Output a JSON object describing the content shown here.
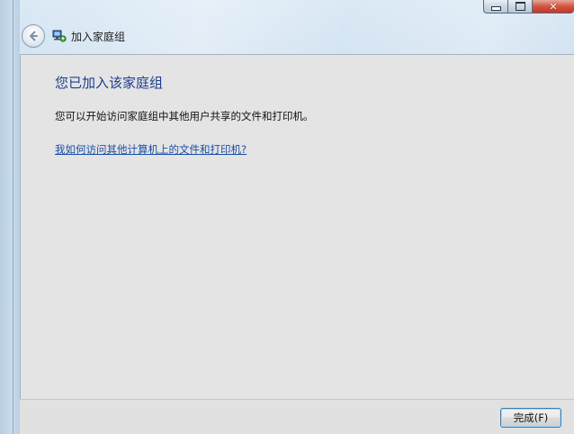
{
  "window": {
    "title": "加入家庭组",
    "caption_buttons": {
      "minimize_icon": "minimize-icon",
      "maximize_icon": "maximize-icon",
      "close_icon": "close-icon",
      "close_glyph": "✕"
    }
  },
  "nav": {
    "back_icon": "back-arrow-icon",
    "app_icon": "homegroup-icon"
  },
  "content": {
    "heading": "您已加入该家庭组",
    "description": "您可以开始访问家庭组中其他用户共享的文件和打印机。",
    "help_link": "我如何访问其他计算机上的文件和打印机?"
  },
  "footer": {
    "finish_label": "完成(F)"
  },
  "colors": {
    "heading": "#1e3d8f",
    "link": "#1a4fa8",
    "content_bg": "#e4e4e4",
    "close_button": "#c0392b"
  }
}
